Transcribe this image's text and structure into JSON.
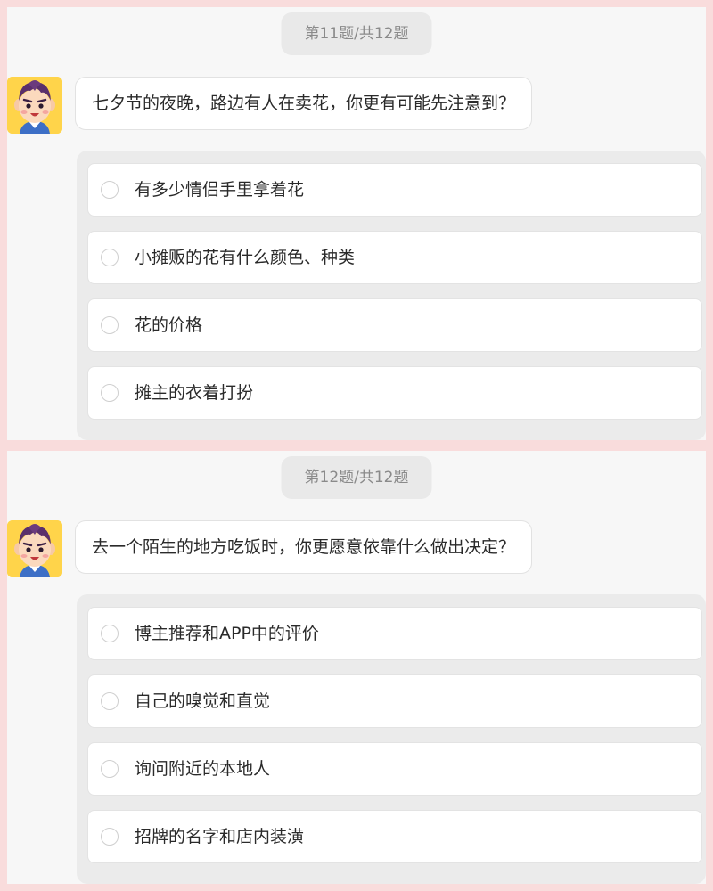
{
  "questions": [
    {
      "counter": "第11题/共12题",
      "avatar_icon": "cartoon-boy-avatar-icon",
      "prompt": "七夕节的夜晚，路边有人在卖花，你更有可能先注意到？",
      "options": [
        {
          "label": "有多少情侣手里拿着花"
        },
        {
          "label": "小摊贩的花有什么颜色、种类"
        },
        {
          "label": "花的价格"
        },
        {
          "label": "摊主的衣着打扮"
        }
      ]
    },
    {
      "counter": "第12题/共12题",
      "avatar_icon": "cartoon-boy-avatar-icon",
      "prompt": "去一个陌生的地方吃饭时，你更愿意依靠什么做出决定？",
      "options": [
        {
          "label": "博主推荐和APP中的评价"
        },
        {
          "label": "自己的嗅觉和直觉"
        },
        {
          "label": "询问附近的本地人"
        },
        {
          "label": "招牌的名字和店内装潢"
        }
      ]
    }
  ],
  "colors": {
    "frame_background": "#f9dcdc",
    "panel_background": "#f7f7f7",
    "avatar_background": "#ffd44a",
    "text": "#2a2a2a",
    "counter_text": "#8a8a8a"
  }
}
